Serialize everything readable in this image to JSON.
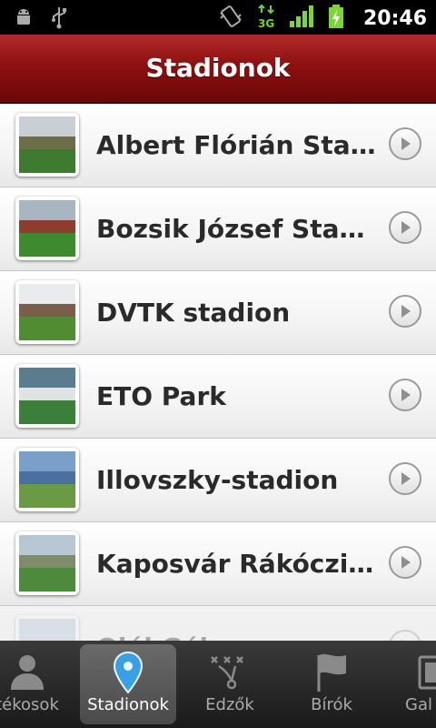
{
  "status_bar": {
    "time": "20:46",
    "icons": [
      "android-debug-icon",
      "usb-icon",
      "vibrate-icon",
      "3g-data-icon",
      "signal-icon",
      "battery-charging-icon"
    ],
    "network_label": "3G"
  },
  "header": {
    "title": "Stadionok"
  },
  "stadiums": [
    {
      "name": "Albert Flórián Stadi...",
      "thumb_colors": [
        "#c9cfd4",
        "#6d6d4a",
        "#3f7a31"
      ]
    },
    {
      "name": "Bozsik József Stadion",
      "thumb_colors": [
        "#a8b6c2",
        "#8e3c2d",
        "#3d8a2f"
      ]
    },
    {
      "name": "DVTK stadion",
      "thumb_colors": [
        "#e8ecee",
        "#7b5d4a",
        "#4f8c32"
      ]
    },
    {
      "name": "ETO Park",
      "thumb_colors": [
        "#5b7b8e",
        "#dfe3e6",
        "#3c7f3a"
      ]
    },
    {
      "name": "Illovszky-stadion",
      "thumb_colors": [
        "#7aa0c9",
        "#4a6fa0",
        "#6a9a45"
      ]
    },
    {
      "name": "Kaposvár Rákóczi St...",
      "thumb_colors": [
        "#b7c7d3",
        "#7f8b6b",
        "#4d8a3c"
      ]
    },
    {
      "name": "Ojál Gál...",
      "thumb_colors": [
        "#b8c8e0",
        "#c9b9a8",
        "#8aa072"
      ]
    }
  ],
  "tabs": [
    {
      "label": "tékosok",
      "icon": "person-icon",
      "active": false
    },
    {
      "label": "Stadionok",
      "icon": "map-pin-icon",
      "active": true
    },
    {
      "label": "Edzők",
      "icon": "tactics-board-icon",
      "active": false
    },
    {
      "label": "Bírók",
      "icon": "flag-icon",
      "active": false
    },
    {
      "label": "Gal",
      "icon": "gallery-icon",
      "active": false
    }
  ],
  "colors": {
    "header_red": "#8d1010",
    "pin_blue": "#3aa0e6"
  }
}
